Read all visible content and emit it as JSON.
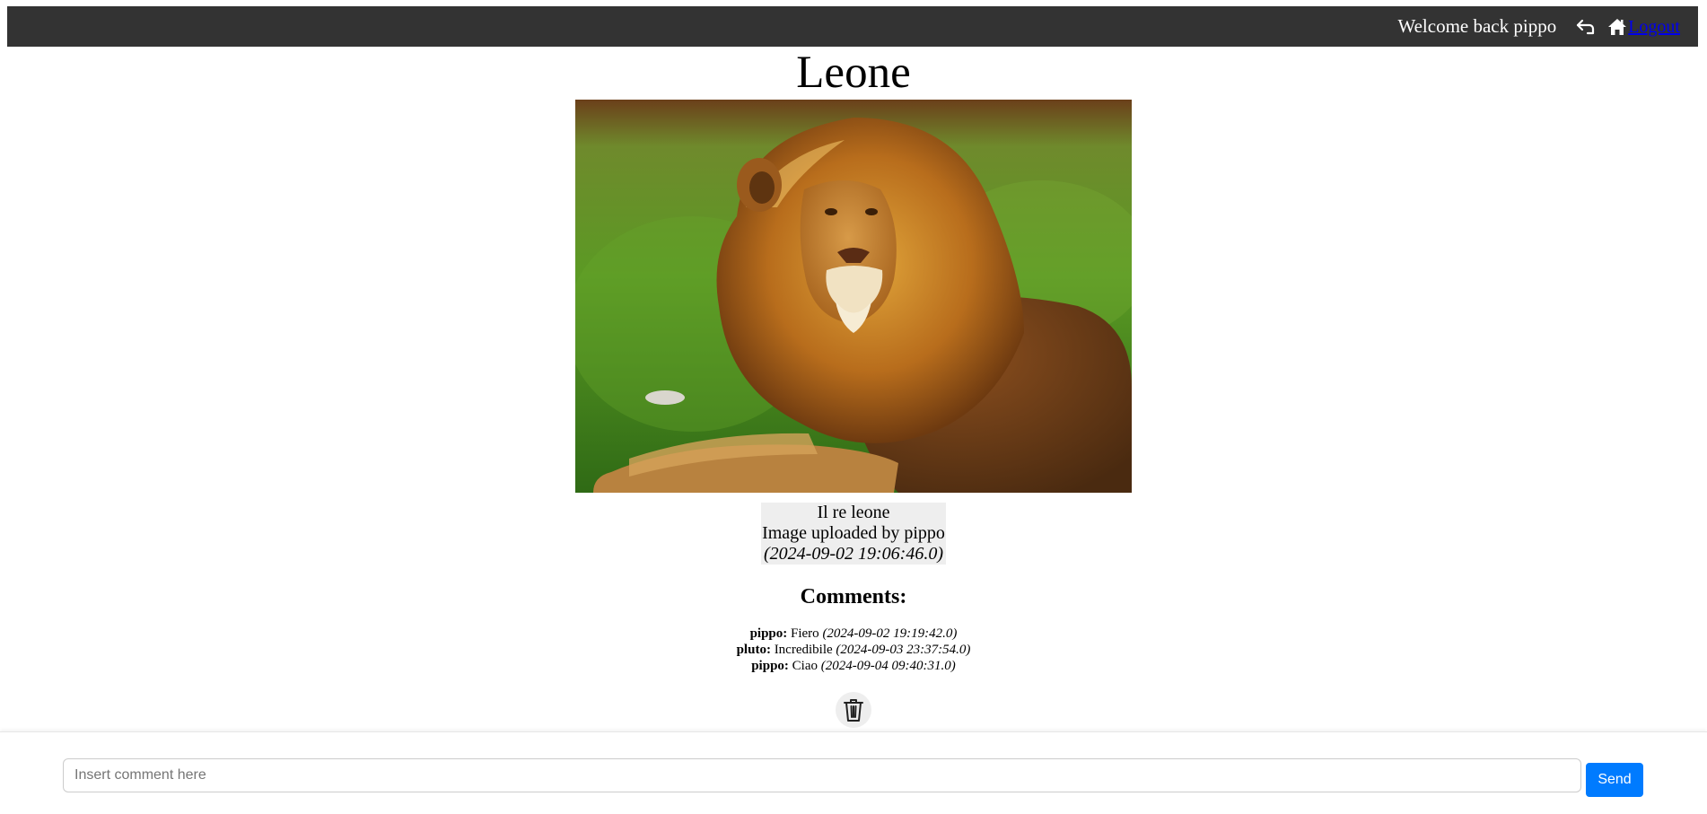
{
  "header": {
    "welcome": "Welcome back pippo",
    "back_icon": "back-arrow-icon",
    "home_icon": "home-icon",
    "logout": "Logout"
  },
  "image": {
    "title": "Leone",
    "description": "Il re leone",
    "uploaded_by": "Image uploaded by pippo",
    "date": "(2024-09-02 19:06:46.0)"
  },
  "comments": {
    "heading": "Comments:",
    "items": [
      {
        "author": "pippo:",
        "text": "Fiero",
        "date": "(2024-09-02 19:19:42.0)"
      },
      {
        "author": "pluto:",
        "text": "Incredibile",
        "date": "(2024-09-03 23:37:54.0)"
      },
      {
        "author": "pippo:",
        "text": "Ciao",
        "date": "(2024-09-04 09:40:31.0)"
      }
    ],
    "delete_icon": "trash-icon"
  },
  "form": {
    "placeholder": "Insert comment here",
    "send_label": "Send"
  },
  "colors": {
    "topbar": "#333333",
    "send_button": "#007bff",
    "caption_bg": "#eeeeee"
  }
}
